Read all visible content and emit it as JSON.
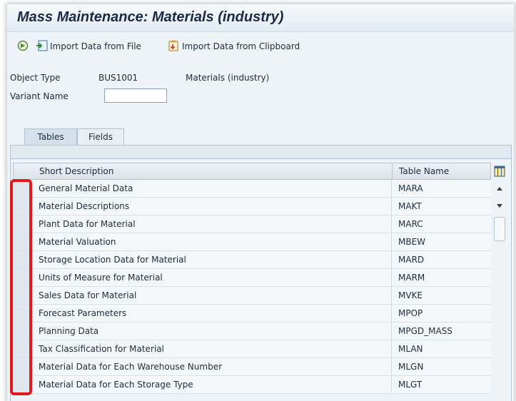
{
  "window": {
    "title": "Mass Maintenance: Materials (industry)"
  },
  "toolbar": {
    "execute_icon": "execute-icon",
    "import_file_label": "Import Data from File",
    "import_clipboard_label": "Import Data from Clipboard"
  },
  "form": {
    "object_type_label": "Object Type",
    "object_type_value": "BUS1001",
    "object_type_desc": "Materials (industry)",
    "variant_name_label": "Variant Name",
    "variant_name_value": ""
  },
  "tabs": [
    {
      "label": "Tables",
      "active": true
    },
    {
      "label": "Fields",
      "active": false
    }
  ],
  "table": {
    "columns": [
      "Short Description",
      "Table Name"
    ],
    "rows": [
      {
        "desc": "General Material Data",
        "name": "MARA"
      },
      {
        "desc": "Material Descriptions",
        "name": "MAKT"
      },
      {
        "desc": "Plant Data for Material",
        "name": "MARC"
      },
      {
        "desc": "Material Valuation",
        "name": "MBEW"
      },
      {
        "desc": "Storage Location Data for Material",
        "name": "MARD"
      },
      {
        "desc": "Units of Measure for Material",
        "name": "MARM"
      },
      {
        "desc": "Sales Data for Material",
        "name": "MVKE"
      },
      {
        "desc": "Forecast Parameters",
        "name": "MPOP"
      },
      {
        "desc": "Planning Data",
        "name": "MPGD_MASS"
      },
      {
        "desc": "Tax Classification for Material",
        "name": "MLAN"
      },
      {
        "desc": "Material Data for Each Warehouse Number",
        "name": "MLGN"
      },
      {
        "desc": "Material Data for Each Storage Type",
        "name": "MLGT"
      }
    ]
  },
  "colors": {
    "highlight": "#e1191b",
    "title_bar": "#e3ebf2",
    "background": "#eef3f7"
  }
}
